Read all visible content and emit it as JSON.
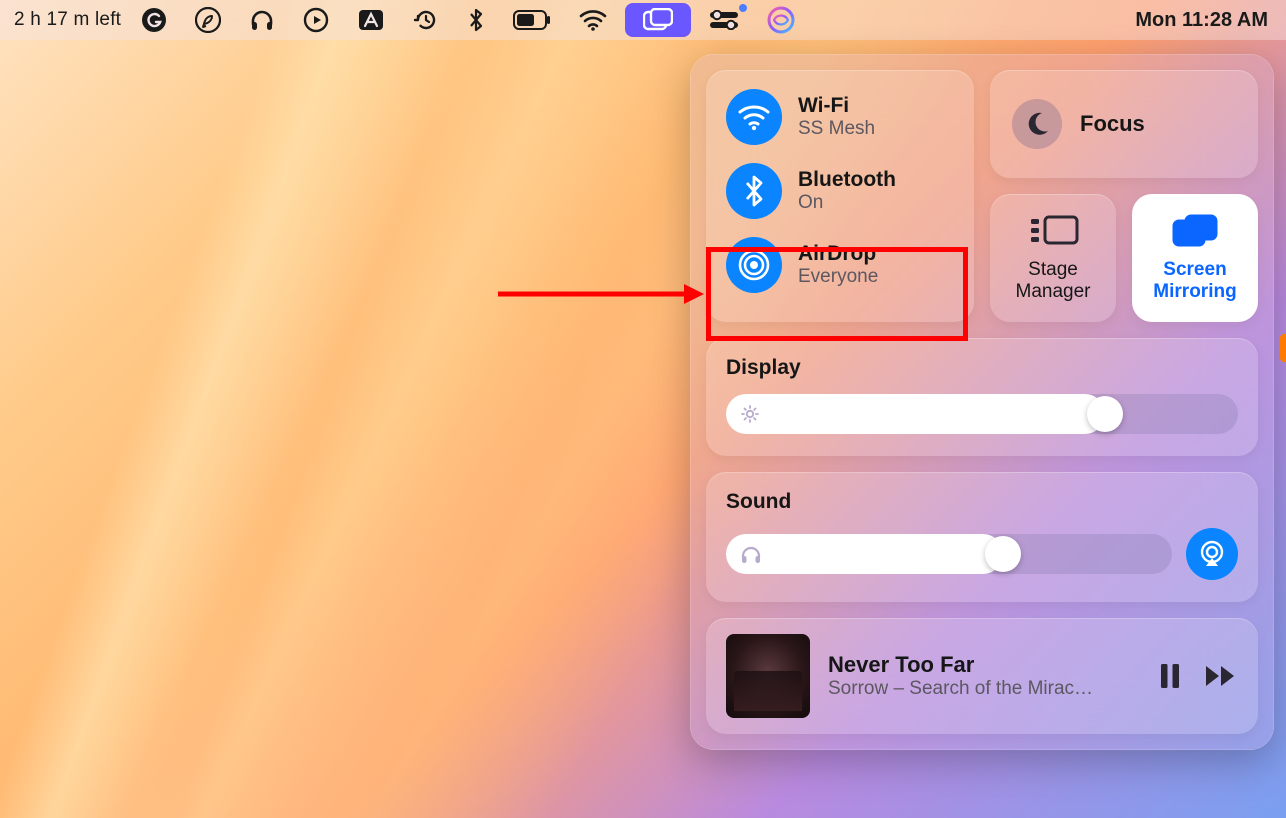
{
  "menubar": {
    "battery_time": "2 h 17 m left",
    "clock": "Mon 11:28 AM"
  },
  "control_center": {
    "wifi": {
      "title": "Wi-Fi",
      "sub": "SS Mesh"
    },
    "bluetooth": {
      "title": "Bluetooth",
      "sub": "On"
    },
    "airdrop": {
      "title": "AirDrop",
      "sub": "Everyone"
    },
    "focus": {
      "label": "Focus"
    },
    "stage_manager": {
      "label": "Stage Manager"
    },
    "screen_mirroring": {
      "label": "Screen Mirroring"
    },
    "display": {
      "title": "Display",
      "value_pct": 74
    },
    "sound": {
      "title": "Sound",
      "value_pct": 62
    },
    "now_playing": {
      "title": "Never Too Far",
      "subtitle": "Sorrow – Search of the Mirac…"
    }
  },
  "highlight": {
    "target": "airdrop"
  },
  "colors": {
    "accent_blue": "#0a84ff",
    "highlight_red": "#ff0000",
    "menubar_hl": "#6a57ff"
  }
}
